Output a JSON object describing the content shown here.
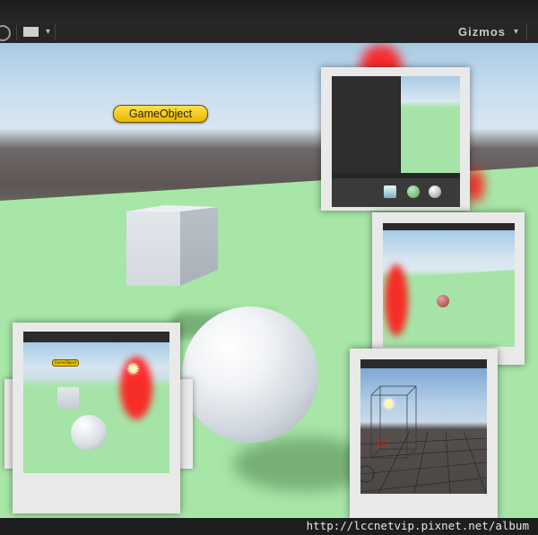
{
  "toolbar": {
    "gizmos_label": "Gizmos",
    "gizmos_caret": "▾",
    "view_caret": "▾"
  },
  "scene": {
    "selected_object_label": "GameObject"
  },
  "thumbnails": {
    "left_label": "GameObject"
  },
  "watermark": {
    "url": "http://lccnetvip.pixnet.net/album"
  },
  "colors": {
    "sky": "#c9def0",
    "ground": "#a6e3a6",
    "label_yellow": "#ffd21a",
    "light_gizmo_red": "#ff1a1a"
  },
  "icons": [
    "scene-toggle-icon",
    "image-icon",
    "sun-icon"
  ]
}
